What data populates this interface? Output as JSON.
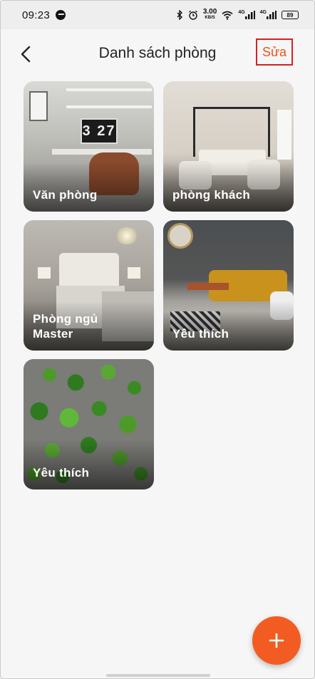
{
  "status_bar": {
    "time": "09:23",
    "net_speed_value": "3.00",
    "net_speed_unit": "KB/S",
    "sim1_tag": "4G",
    "sim2_tag": "4G",
    "battery": "89"
  },
  "header": {
    "title": "Danh sách phòng",
    "edit_label": "Sửa"
  },
  "rooms": [
    {
      "label": "Văn phòng",
      "scene": "office"
    },
    {
      "label": "phòng khách",
      "scene": "living"
    },
    {
      "label": "Phòng ngủ\nMaster",
      "scene": "bedroom"
    },
    {
      "label": "Yêu thích",
      "scene": "lounge"
    },
    {
      "label": "Yêu thích",
      "scene": "ivy"
    }
  ],
  "office_clock": "3 27",
  "fab": {
    "icon": "plus-icon"
  },
  "colors": {
    "accent": "#f25c22",
    "edit_border": "#d91f1f",
    "edit_text": "#e8531e",
    "background": "#f6f6f6"
  }
}
